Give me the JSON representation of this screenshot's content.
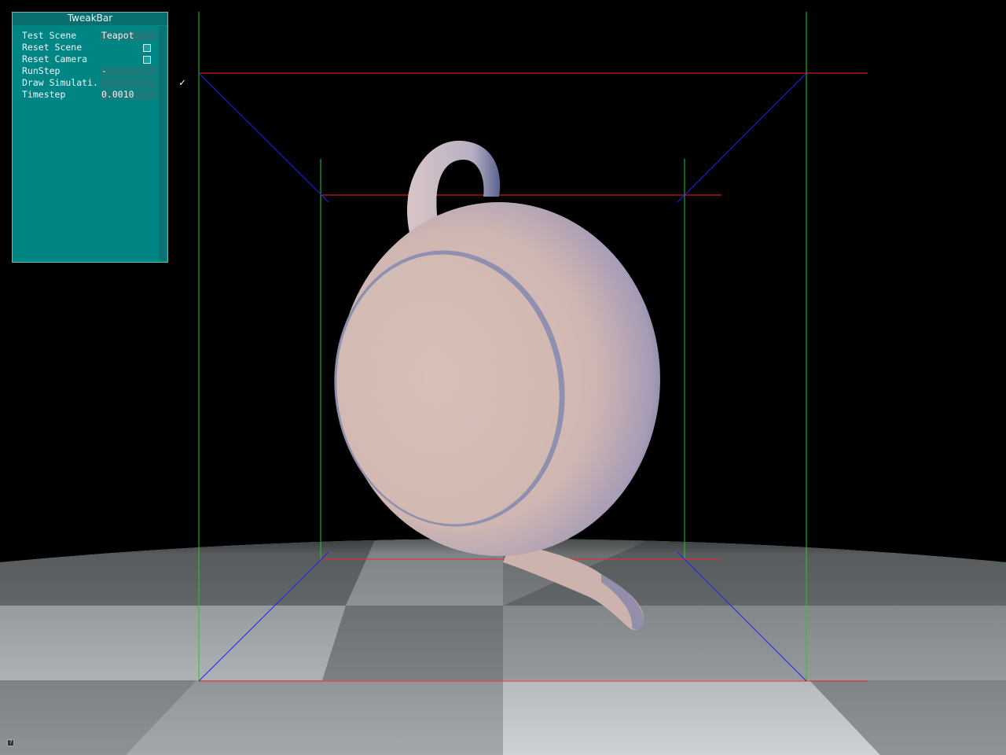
{
  "tweakbar": {
    "title": "TweakBar",
    "rows": [
      {
        "label": "Test Scene",
        "value": "Teapot",
        "kind": "text"
      },
      {
        "label": "Reset Scene",
        "kind": "button"
      },
      {
        "label": "Reset Camera",
        "kind": "button"
      },
      {
        "label": "RunStep",
        "value": "-",
        "kind": "text"
      },
      {
        "label": "Draw Simulati..",
        "value": "✓",
        "kind": "check"
      },
      {
        "label": "Timestep",
        "value": "0.0010",
        "kind": "text"
      }
    ]
  },
  "colors": {
    "panel": "#008585",
    "grid_red": "#ff2020",
    "grid_green": "#22cc22",
    "grid_blue": "#2020ff"
  }
}
